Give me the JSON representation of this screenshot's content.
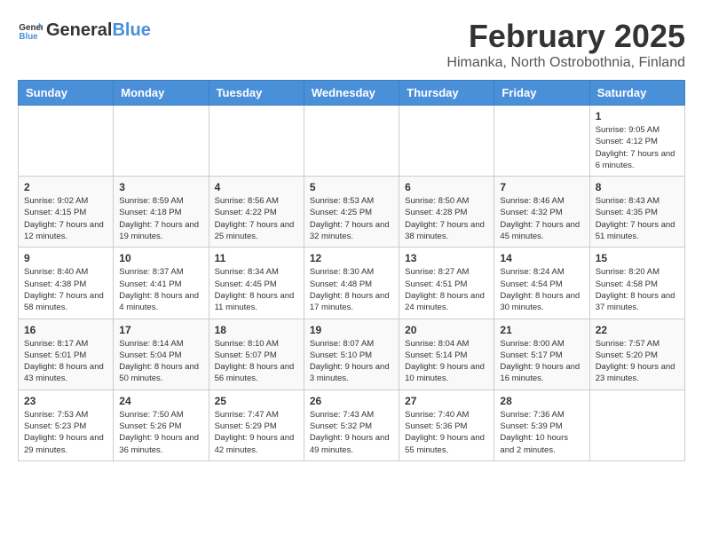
{
  "logo": {
    "general": "General",
    "blue": "Blue"
  },
  "header": {
    "month_year": "February 2025",
    "location": "Himanka, North Ostrobothnia, Finland"
  },
  "weekdays": [
    "Sunday",
    "Monday",
    "Tuesday",
    "Wednesday",
    "Thursday",
    "Friday",
    "Saturday"
  ],
  "weeks": [
    [
      {
        "day": "",
        "info": ""
      },
      {
        "day": "",
        "info": ""
      },
      {
        "day": "",
        "info": ""
      },
      {
        "day": "",
        "info": ""
      },
      {
        "day": "",
        "info": ""
      },
      {
        "day": "",
        "info": ""
      },
      {
        "day": "1",
        "info": "Sunrise: 9:05 AM\nSunset: 4:12 PM\nDaylight: 7 hours and 6 minutes."
      }
    ],
    [
      {
        "day": "2",
        "info": "Sunrise: 9:02 AM\nSunset: 4:15 PM\nDaylight: 7 hours and 12 minutes."
      },
      {
        "day": "3",
        "info": "Sunrise: 8:59 AM\nSunset: 4:18 PM\nDaylight: 7 hours and 19 minutes."
      },
      {
        "day": "4",
        "info": "Sunrise: 8:56 AM\nSunset: 4:22 PM\nDaylight: 7 hours and 25 minutes."
      },
      {
        "day": "5",
        "info": "Sunrise: 8:53 AM\nSunset: 4:25 PM\nDaylight: 7 hours and 32 minutes."
      },
      {
        "day": "6",
        "info": "Sunrise: 8:50 AM\nSunset: 4:28 PM\nDaylight: 7 hours and 38 minutes."
      },
      {
        "day": "7",
        "info": "Sunrise: 8:46 AM\nSunset: 4:32 PM\nDaylight: 7 hours and 45 minutes."
      },
      {
        "day": "8",
        "info": "Sunrise: 8:43 AM\nSunset: 4:35 PM\nDaylight: 7 hours and 51 minutes."
      }
    ],
    [
      {
        "day": "9",
        "info": "Sunrise: 8:40 AM\nSunset: 4:38 PM\nDaylight: 7 hours and 58 minutes."
      },
      {
        "day": "10",
        "info": "Sunrise: 8:37 AM\nSunset: 4:41 PM\nDaylight: 8 hours and 4 minutes."
      },
      {
        "day": "11",
        "info": "Sunrise: 8:34 AM\nSunset: 4:45 PM\nDaylight: 8 hours and 11 minutes."
      },
      {
        "day": "12",
        "info": "Sunrise: 8:30 AM\nSunset: 4:48 PM\nDaylight: 8 hours and 17 minutes."
      },
      {
        "day": "13",
        "info": "Sunrise: 8:27 AM\nSunset: 4:51 PM\nDaylight: 8 hours and 24 minutes."
      },
      {
        "day": "14",
        "info": "Sunrise: 8:24 AM\nSunset: 4:54 PM\nDaylight: 8 hours and 30 minutes."
      },
      {
        "day": "15",
        "info": "Sunrise: 8:20 AM\nSunset: 4:58 PM\nDaylight: 8 hours and 37 minutes."
      }
    ],
    [
      {
        "day": "16",
        "info": "Sunrise: 8:17 AM\nSunset: 5:01 PM\nDaylight: 8 hours and 43 minutes."
      },
      {
        "day": "17",
        "info": "Sunrise: 8:14 AM\nSunset: 5:04 PM\nDaylight: 8 hours and 50 minutes."
      },
      {
        "day": "18",
        "info": "Sunrise: 8:10 AM\nSunset: 5:07 PM\nDaylight: 8 hours and 56 minutes."
      },
      {
        "day": "19",
        "info": "Sunrise: 8:07 AM\nSunset: 5:10 PM\nDaylight: 9 hours and 3 minutes."
      },
      {
        "day": "20",
        "info": "Sunrise: 8:04 AM\nSunset: 5:14 PM\nDaylight: 9 hours and 10 minutes."
      },
      {
        "day": "21",
        "info": "Sunrise: 8:00 AM\nSunset: 5:17 PM\nDaylight: 9 hours and 16 minutes."
      },
      {
        "day": "22",
        "info": "Sunrise: 7:57 AM\nSunset: 5:20 PM\nDaylight: 9 hours and 23 minutes."
      }
    ],
    [
      {
        "day": "23",
        "info": "Sunrise: 7:53 AM\nSunset: 5:23 PM\nDaylight: 9 hours and 29 minutes."
      },
      {
        "day": "24",
        "info": "Sunrise: 7:50 AM\nSunset: 5:26 PM\nDaylight: 9 hours and 36 minutes."
      },
      {
        "day": "25",
        "info": "Sunrise: 7:47 AM\nSunset: 5:29 PM\nDaylight: 9 hours and 42 minutes."
      },
      {
        "day": "26",
        "info": "Sunrise: 7:43 AM\nSunset: 5:32 PM\nDaylight: 9 hours and 49 minutes."
      },
      {
        "day": "27",
        "info": "Sunrise: 7:40 AM\nSunset: 5:36 PM\nDaylight: 9 hours and 55 minutes."
      },
      {
        "day": "28",
        "info": "Sunrise: 7:36 AM\nSunset: 5:39 PM\nDaylight: 10 hours and 2 minutes."
      },
      {
        "day": "",
        "info": ""
      }
    ]
  ]
}
